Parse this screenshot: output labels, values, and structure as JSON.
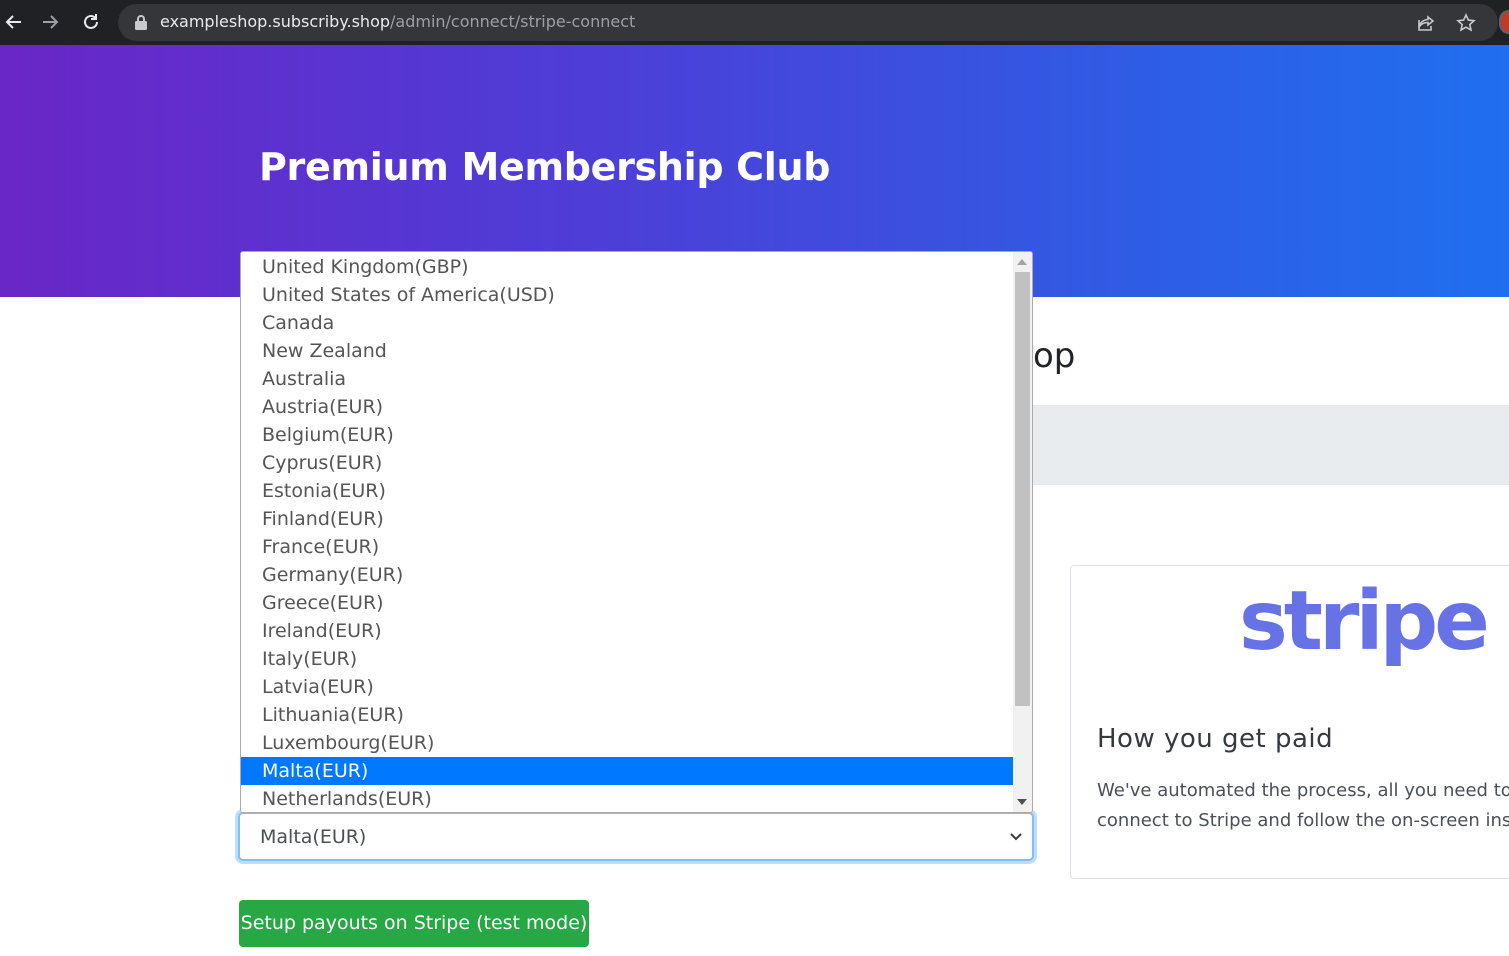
{
  "browser": {
    "url_host": "exampleshop.subscriby.shop",
    "url_path": "/admin/connect/stripe-connect"
  },
  "hero": {
    "title": "Premium Membership Club"
  },
  "page": {
    "partial_heading": "op"
  },
  "stripe_card": {
    "logo_text": "stripe",
    "title": "How you get paid",
    "text_line1": "We've automated the process, all you need to do",
    "text_line2": "connect to Stripe and follow the on-screen instr"
  },
  "country_select": {
    "selected_value": "Malta(EUR)",
    "options": [
      "United Kingdom(GBP)",
      "United States of America(USD)",
      "Canada",
      "New Zealand",
      "Australia",
      "Austria(EUR)",
      "Belgium(EUR)",
      "Cyprus(EUR)",
      "Estonia(EUR)",
      "Finland(EUR)",
      "France(EUR)",
      "Germany(EUR)",
      "Greece(EUR)",
      "Ireland(EUR)",
      "Italy(EUR)",
      "Latvia(EUR)",
      "Lithuania(EUR)",
      "Luxembourg(EUR)",
      "Malta(EUR)",
      "Netherlands(EUR)"
    ],
    "highlighted_index": 18
  },
  "actions": {
    "setup_button_label": "Setup payouts on Stripe (test mode)"
  },
  "colors": {
    "stripe_brand": "#6772e5",
    "button_green": "#28a745",
    "selected_option": "#0078ff",
    "hero_start": "#6a26c7",
    "hero_end": "#1f6ff0"
  }
}
